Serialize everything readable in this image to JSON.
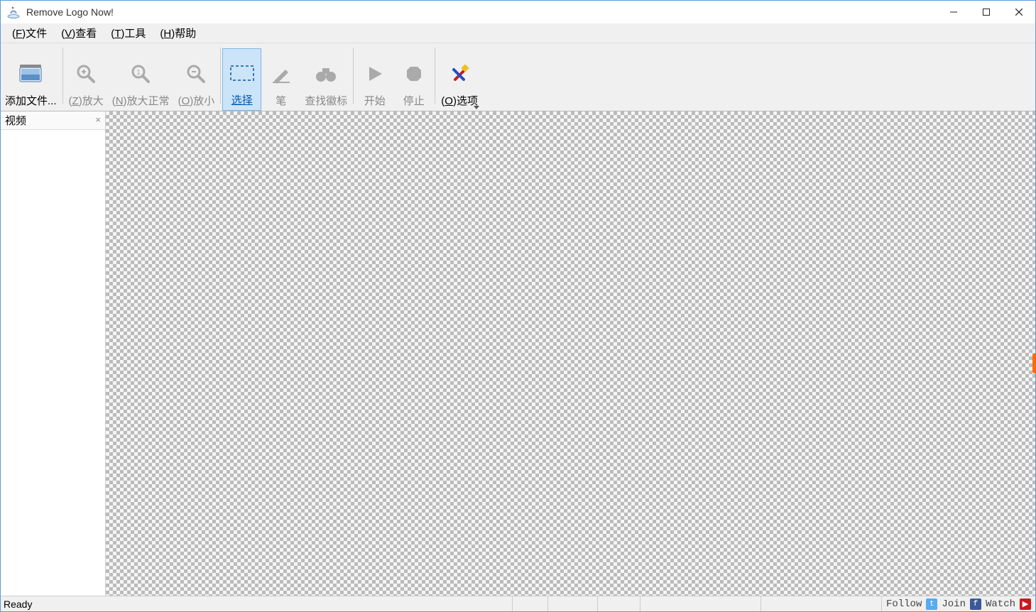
{
  "window": {
    "title": "Remove Logo Now!"
  },
  "menu": {
    "file_hot": "F",
    "file": "文件",
    "view_hot": "V",
    "view": "查看",
    "tools_hot": "T",
    "tools": "工具",
    "help_hot": "H",
    "help": "帮助"
  },
  "toolbar": {
    "add_files": "添加文件...",
    "zoom_in_hot": "Z",
    "zoom_in": "放大",
    "zoom_normal_hot": "N",
    "zoom_normal": "放大正常",
    "zoom_out_hot": "O",
    "zoom_out": "放小",
    "select": "选择",
    "pen": "笔",
    "find_logo": "查找徽标",
    "start": "开始",
    "stop": "停止",
    "options_hot": "O",
    "options": "选项"
  },
  "side": {
    "tab_title": "视频"
  },
  "status": {
    "ready": "Ready",
    "follow": "Follow",
    "join": "Join",
    "watch": "Watch"
  }
}
